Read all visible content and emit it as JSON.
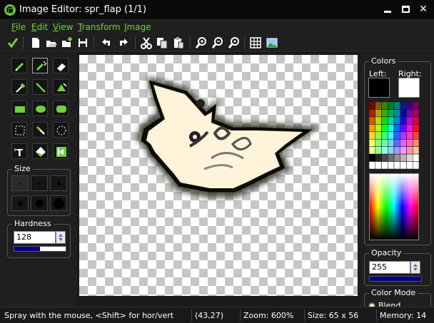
{
  "window": {
    "title": "Image Editor: spr_flap (1/1)"
  },
  "menu": [
    "File",
    "Edit",
    "View",
    "Transform",
    "Image"
  ],
  "toolbar_icons": [
    "checkmark-icon",
    "new-icon",
    "open-icon",
    "add-image-icon",
    "save-icon",
    "undo-icon",
    "redo-icon",
    "cut-icon",
    "copy-icon",
    "paste-icon",
    "zoom-in-icon",
    "zoom-out-icon",
    "zoom-fit-icon",
    "grid-icon",
    "picture-icon"
  ],
  "tools": [
    "pencil",
    "spray",
    "eraser",
    "color-picker",
    "line",
    "fill",
    "rectangle",
    "ellipse",
    "rounded-rectangle",
    "select",
    "magic-wand",
    "spray-select",
    "text",
    "eraser-select",
    "flip-icon"
  ],
  "size": {
    "label": "Size",
    "selected": 0
  },
  "hardness": {
    "label": "Hardness",
    "value": "128",
    "level": 0.5
  },
  "colors": {
    "label": "Colors",
    "left_label": "Left:",
    "right_label": "Right:",
    "left_color": "#000000",
    "right_color": "#ffffff"
  },
  "opacity": {
    "label": "Opacity",
    "value": "255",
    "level": 1.0
  },
  "color_mode": {
    "label": "Color Mode",
    "option": "Blend"
  },
  "status": {
    "hint": "Spray with the mouse, <Shift> for hor/vert",
    "coords": "(43,27)",
    "zoom": "Zoom: 600%",
    "size": "Size: 65 x 56",
    "memory": "Memory: 14 KB"
  },
  "accent_color": "#6fd23a"
}
